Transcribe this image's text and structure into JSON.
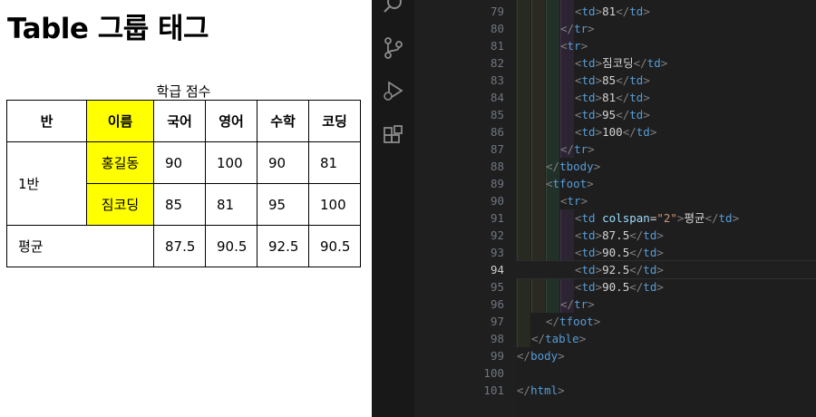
{
  "preview": {
    "heading": "Table 그룹 태그",
    "caption": "학급 점수",
    "headers": [
      "반",
      "이름",
      "국어",
      "영어",
      "수학",
      "코딩"
    ],
    "rows": [
      {
        "class": "1반",
        "name": "홍길동",
        "scores": [
          "90",
          "100",
          "90",
          "81"
        ]
      },
      {
        "name": "짐코딩",
        "scores": [
          "85",
          "81",
          "95",
          "100"
        ]
      }
    ],
    "footer": {
      "label": "평균",
      "scores": [
        "87.5",
        "90.5",
        "92.5",
        "90.5"
      ]
    },
    "highlight_color": "#ffff00"
  },
  "editor": {
    "activity_icons": [
      "search-icon",
      "source-control-icon",
      "run-debug-icon",
      "extensions-icon"
    ],
    "active_line": "94",
    "lines": [
      {
        "no": "79",
        "indent": 4,
        "code": "<td>81</td>"
      },
      {
        "no": "80",
        "indent": 3,
        "code": "</tr>"
      },
      {
        "no": "81",
        "indent": 3,
        "code": "<tr>"
      },
      {
        "no": "82",
        "indent": 4,
        "code": "<td>짐코딩</td>"
      },
      {
        "no": "83",
        "indent": 4,
        "code": "<td>85</td>"
      },
      {
        "no": "84",
        "indent": 4,
        "code": "<td>81</td>"
      },
      {
        "no": "85",
        "indent": 4,
        "code": "<td>95</td>"
      },
      {
        "no": "86",
        "indent": 4,
        "code": "<td>100</td>"
      },
      {
        "no": "87",
        "indent": 3,
        "code": "</tr>"
      },
      {
        "no": "88",
        "indent": 2,
        "code": "</tbody>"
      },
      {
        "no": "89",
        "indent": 2,
        "code": "<tfoot>"
      },
      {
        "no": "90",
        "indent": 3,
        "code": "<tr>"
      },
      {
        "no": "91",
        "indent": 4,
        "code": "<td colspan=\"2\">평균</td>"
      },
      {
        "no": "92",
        "indent": 4,
        "code": "<td>87.5</td>"
      },
      {
        "no": "93",
        "indent": 4,
        "code": "<td>90.5</td>"
      },
      {
        "no": "94",
        "indent": 4,
        "code": "<td>92.5</td>"
      },
      {
        "no": "95",
        "indent": 4,
        "code": "<td>90.5</td>"
      },
      {
        "no": "96",
        "indent": 3,
        "code": "</tr>"
      },
      {
        "no": "97",
        "indent": 2,
        "code": "</tfoot>"
      },
      {
        "no": "98",
        "indent": 1,
        "code": "</table>"
      },
      {
        "no": "99",
        "indent": 0,
        "code": "</body>"
      },
      {
        "no": "100",
        "indent": 0,
        "code": ""
      },
      {
        "no": "101",
        "indent": 0,
        "code": "</html>"
      }
    ],
    "colors": {
      "background": "#1e1e1e",
      "tag": "#569cd6",
      "bracket": "#808080",
      "attr": "#9cdcfe",
      "string": "#ce9178",
      "text": "#d4d4d4"
    }
  }
}
